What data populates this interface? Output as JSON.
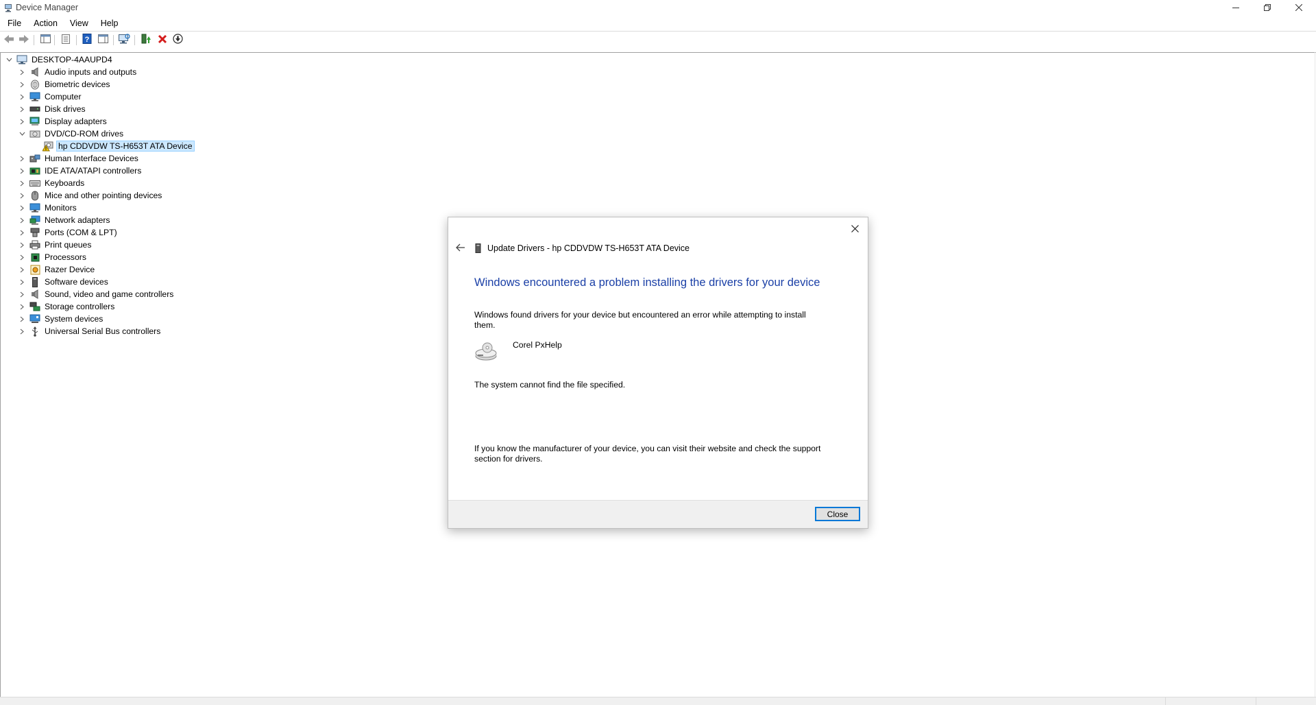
{
  "window": {
    "title": "Device Manager",
    "controls": {
      "minimize": "minimize-icon",
      "restore": "restore-icon",
      "close": "close-icon"
    }
  },
  "menu": [
    "File",
    "Action",
    "View",
    "Help"
  ],
  "toolbar": {
    "buttons": [
      "back-arrow-icon",
      "forward-arrow-icon",
      "show-hide-console-tree-icon",
      "properties-icon",
      "help-icon",
      "action-pane-icon",
      "scan-hardware-icon",
      "update-driver-icon",
      "uninstall-device-icon",
      "disable-device-icon"
    ]
  },
  "tree": {
    "root": "DESKTOP-4AAUPD4",
    "categories": [
      {
        "label": "Audio inputs and outputs",
        "icon": "speaker-icon",
        "expanded": false
      },
      {
        "label": "Biometric devices",
        "icon": "fingerprint-icon",
        "expanded": false
      },
      {
        "label": "Computer",
        "icon": "computer-icon",
        "expanded": false
      },
      {
        "label": "Disk drives",
        "icon": "disk-drive-icon",
        "expanded": false
      },
      {
        "label": "Display adapters",
        "icon": "display-adapter-icon",
        "expanded": false
      },
      {
        "label": "DVD/CD-ROM drives",
        "icon": "dvd-drive-icon",
        "expanded": true,
        "children": [
          {
            "label": "hp CDDVDW TS-H653T ATA Device",
            "icon": "warning-dvd-icon",
            "selected": true
          }
        ]
      },
      {
        "label": "Human Interface Devices",
        "icon": "hid-icon",
        "expanded": false
      },
      {
        "label": "IDE ATA/ATAPI controllers",
        "icon": "ide-controller-icon",
        "expanded": false
      },
      {
        "label": "Keyboards",
        "icon": "keyboard-icon",
        "expanded": false
      },
      {
        "label": "Mice and other pointing devices",
        "icon": "mouse-icon",
        "expanded": false
      },
      {
        "label": "Monitors",
        "icon": "monitor-icon",
        "expanded": false
      },
      {
        "label": "Network adapters",
        "icon": "network-adapter-icon",
        "expanded": false
      },
      {
        "label": "Ports (COM & LPT)",
        "icon": "port-icon",
        "expanded": false
      },
      {
        "label": "Print queues",
        "icon": "printer-icon",
        "expanded": false
      },
      {
        "label": "Processors",
        "icon": "processor-icon",
        "expanded": false
      },
      {
        "label": "Razer Device",
        "icon": "razer-device-icon",
        "expanded": false
      },
      {
        "label": "Software devices",
        "icon": "software-device-icon",
        "expanded": false
      },
      {
        "label": "Sound, video and game controllers",
        "icon": "sound-icon",
        "expanded": false
      },
      {
        "label": "Storage controllers",
        "icon": "storage-controller-icon",
        "expanded": false
      },
      {
        "label": "System devices",
        "icon": "system-device-icon",
        "expanded": false
      },
      {
        "label": "Universal Serial Bus controllers",
        "icon": "usb-icon",
        "expanded": false
      }
    ]
  },
  "dialog": {
    "header_title": "Update Drivers - hp CDDVDW TS-H653T ATA Device",
    "heading": "Windows encountered a problem installing the drivers for your device",
    "message": "Windows found drivers for your device but encountered an error while attempting to install them.",
    "driver_name": "Corel PxHelp",
    "error": "The system cannot find the file specified.",
    "hint": "If you know the manufacturer of your device, you can visit their website and check the support section for drivers.",
    "close_button": "Close"
  },
  "colors": {
    "heading_blue": "#1a3fa6",
    "selection_bg": "#cce8ff",
    "selection_border": "#99d1ff",
    "button_focus_border": "#0078d7",
    "footer_bg": "#f0f0f0"
  }
}
